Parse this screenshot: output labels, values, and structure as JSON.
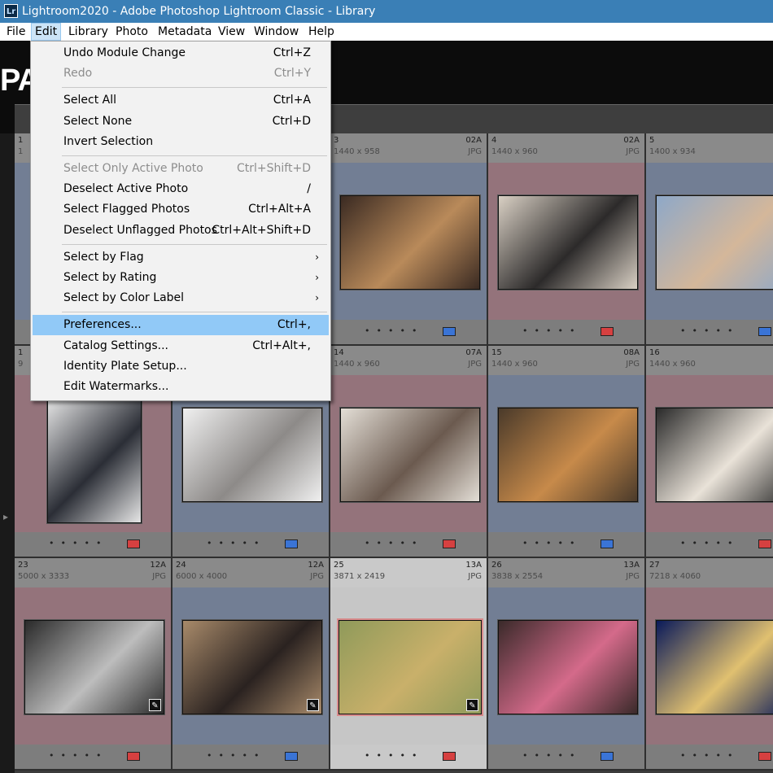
{
  "window": {
    "title": "Lightroom2020 - Adobe Photoshop Lightroom Classic - Library",
    "app_icon": "Lr"
  },
  "menubar": [
    "File",
    "Edit",
    "Library",
    "Photo",
    "Metadata",
    "View",
    "Window",
    "Help"
  ],
  "identity_plate": "PA",
  "edit_menu": {
    "groups": [
      [
        {
          "label": "Undo Module Change",
          "shortcut": "Ctrl+Z",
          "disabled": false
        },
        {
          "label": "Redo",
          "shortcut": "Ctrl+Y",
          "disabled": true
        }
      ],
      [
        {
          "label": "Select All",
          "shortcut": "Ctrl+A",
          "disabled": false
        },
        {
          "label": "Select None",
          "shortcut": "Ctrl+D",
          "disabled": false
        },
        {
          "label": "Invert Selection",
          "shortcut": "",
          "disabled": false
        }
      ],
      [
        {
          "label": "Select Only Active Photo",
          "shortcut": "Ctrl+Shift+D",
          "disabled": true
        },
        {
          "label": "Deselect Active Photo",
          "shortcut": "/",
          "disabled": false
        },
        {
          "label": "Select Flagged Photos",
          "shortcut": "Ctrl+Alt+A",
          "disabled": false
        },
        {
          "label": "Deselect Unflagged Photos",
          "shortcut": "Ctrl+Alt+Shift+D",
          "disabled": false
        }
      ],
      [
        {
          "label": "Select by Flag",
          "shortcut": "",
          "submenu": true,
          "disabled": false
        },
        {
          "label": "Select by Rating",
          "shortcut": "",
          "submenu": true,
          "disabled": false
        },
        {
          "label": "Select by Color Label",
          "shortcut": "",
          "submenu": true,
          "disabled": false
        }
      ],
      [
        {
          "label": "Preferences...",
          "shortcut": "Ctrl+,",
          "highlighted": true,
          "disabled": false
        },
        {
          "label": "Catalog Settings...",
          "shortcut": "Ctrl+Alt+,",
          "disabled": false
        },
        {
          "label": "Identity Plate Setup...",
          "shortcut": "",
          "disabled": false
        },
        {
          "label": "Edit Watermarks...",
          "shortcut": "",
          "disabled": false
        }
      ]
    ]
  },
  "colors": {
    "blue_bg": "#727e94",
    "red_bg": "#94737b",
    "blue_label": "#3a74d6",
    "red_label": "#d64040",
    "selected_bg": "#c6c6c6"
  },
  "photos": [
    {
      "num": "1",
      "dims": "1",
      "code": "",
      "ext": "",
      "bg": "blue",
      "label": "blue"
    },
    {
      "num": "",
      "dims": "",
      "code": "",
      "ext": "",
      "bg": "blue",
      "label": "blue"
    },
    {
      "num": "3",
      "dims": "1440 x 958",
      "code": "02A",
      "ext": "JPG",
      "bg": "blue",
      "label": "blue",
      "tone": [
        "#3a2a22",
        "#b98a5a"
      ]
    },
    {
      "num": "4",
      "dims": "1440 x 960",
      "code": "02A",
      "ext": "JPG",
      "bg": "red",
      "label": "red",
      "tone": [
        "#d9d0c4",
        "#2c2a2a"
      ]
    },
    {
      "num": "5",
      "dims": "1400 x 934",
      "code": "",
      "ext": "",
      "bg": "blue",
      "label": "blue",
      "tone": [
        "#8ea8c8",
        "#d4b79a"
      ]
    },
    {
      "num": "1",
      "dims": "9",
      "code": "",
      "ext": "",
      "bg": "red",
      "label": "red",
      "tone": [
        "#e6e6e6",
        "#2b2e36"
      ]
    },
    {
      "num": "",
      "dims": "",
      "code": "",
      "ext": "",
      "bg": "blue",
      "label": "blue",
      "tone": [
        "#f0f0f0",
        "#8d8a88"
      ]
    },
    {
      "num": "14",
      "dims": "1440 x 960",
      "code": "07A",
      "ext": "JPG",
      "bg": "red",
      "label": "red",
      "tone": [
        "#e3ded6",
        "#6b5a4f"
      ]
    },
    {
      "num": "15",
      "dims": "1440 x 960",
      "code": "08A",
      "ext": "JPG",
      "bg": "blue",
      "label": "blue",
      "tone": [
        "#4a3a2a",
        "#c78a4a"
      ]
    },
    {
      "num": "16",
      "dims": "1440 x 960",
      "code": "",
      "ext": "",
      "bg": "red",
      "label": "red",
      "tone": [
        "#2a2a2a",
        "#e9e2d8"
      ]
    },
    {
      "num": "23",
      "dims": "5000 x 3333",
      "code": "12A",
      "ext": "JPG",
      "bg": "red",
      "label": "red",
      "tone": [
        "#2a2a2a",
        "#bdbdbd"
      ],
      "badge": true
    },
    {
      "num": "24",
      "dims": "6000 x 4000",
      "code": "12A",
      "ext": "JPG",
      "bg": "blue",
      "label": "blue",
      "tone": [
        "#a88a6a",
        "#2a2220"
      ],
      "badge": true
    },
    {
      "num": "25",
      "dims": "3871 x 2419",
      "code": "13A",
      "ext": "JPG",
      "bg": "selected",
      "label": "red",
      "tone": [
        "#8f9a5a",
        "#c9b06a"
      ],
      "badge": true
    },
    {
      "num": "26",
      "dims": "3838 x 2554",
      "code": "13A",
      "ext": "JPG",
      "bg": "blue",
      "label": "blue",
      "tone": [
        "#3a2a2a",
        "#d46a8a"
      ]
    },
    {
      "num": "27",
      "dims": "7218 x 4060",
      "code": "",
      "ext": "",
      "bg": "red",
      "label": "red",
      "tone": [
        "#0a1a5a",
        "#e0c070"
      ]
    }
  ]
}
